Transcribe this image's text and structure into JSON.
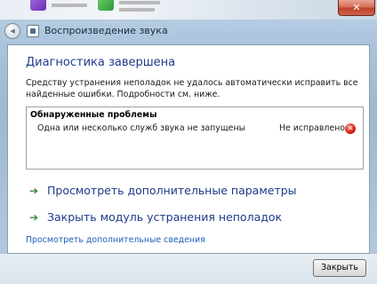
{
  "window": {
    "close_glyph": "✕"
  },
  "nav": {
    "back_glyph": "◂",
    "title": "Воспроизведение звука"
  },
  "main": {
    "heading": "Диагностика завершена",
    "description": "Средству устранения неполадок не удалось автоматически исправить все найденные ошибки. Подробности см. ниже.",
    "problems": {
      "header": "Обнаруженные проблемы",
      "items": [
        {
          "name": "Одна или несколько служб звука не запущены",
          "status": "Не исправлено",
          "status_icon": "error-icon",
          "status_glyph": "✕"
        }
      ]
    },
    "actions": [
      {
        "label": "Просмотреть дополнительные параметры",
        "icon": "green-arrow-icon",
        "glyph": "➔"
      },
      {
        "label": "Закрыть модуль устранения неполадок",
        "icon": "green-arrow-icon",
        "glyph": "➔"
      }
    ],
    "more_info_link": "Просмотреть дополнительные сведения"
  },
  "footer": {
    "close_button": "Закрыть"
  },
  "colors": {
    "heading": "#1e3a8a",
    "link": "#1f5fb8",
    "arrow": "#2e8b2e",
    "error": "#d0241a"
  }
}
